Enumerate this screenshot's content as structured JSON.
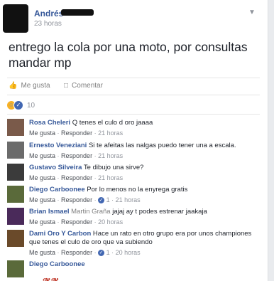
{
  "post": {
    "author": "Andrés",
    "timestamp": "23 horas",
    "text": "entrego la cola por una moto, por consultas mandar mp",
    "like_label": "Me gusta",
    "comment_label": "Comentar",
    "reaction_count": "10"
  },
  "comments": [
    {
      "name": "Rosa Cheleri",
      "text": "Q tenes el culo d oro jaaaa",
      "reply_count": "",
      "time": "21 horas",
      "avatar_color": "#7a5a4a"
    },
    {
      "name": "Ernesto Veneziani",
      "text": "Si te afeitas las nalgas puedo tener una a escala.",
      "reply_count": "",
      "time": "21 horas",
      "avatar_color": "#6b6b6b"
    },
    {
      "name": "Gustavo Silveira",
      "text": "Te dibujo una sirve?",
      "reply_count": "",
      "time": "21 horas",
      "avatar_color": "#3b3b3b"
    },
    {
      "name": "Diego Carboonee",
      "text": "Por lo menos no la enyrega gratis",
      "reply_count": "1",
      "time": "21 horas",
      "avatar_color": "#5a6a3a"
    },
    {
      "name": "Brian Ismael",
      "tag": "Martin Graña",
      "text": "jajaj ay t podes estrenar jaakaja",
      "reply_count": "",
      "time": "20 horas",
      "avatar_color": "#4a2a5a"
    },
    {
      "name": "Dami Oro Y Carbon",
      "text": "Hace un rato en otro grupo era por unos championes que tenes el culo de oro que va subiendo",
      "reply_count": "1",
      "time": "20 horas",
      "avatar_color": "#6a4a2a"
    },
    {
      "name": "Diego Carboonee",
      "text": "",
      "reply_count": "",
      "time": "",
      "avatar_color": "#5a6a3a"
    }
  ],
  "meta_labels": {
    "like": "Me gusta",
    "reply": "Responder",
    "sep": " · "
  }
}
